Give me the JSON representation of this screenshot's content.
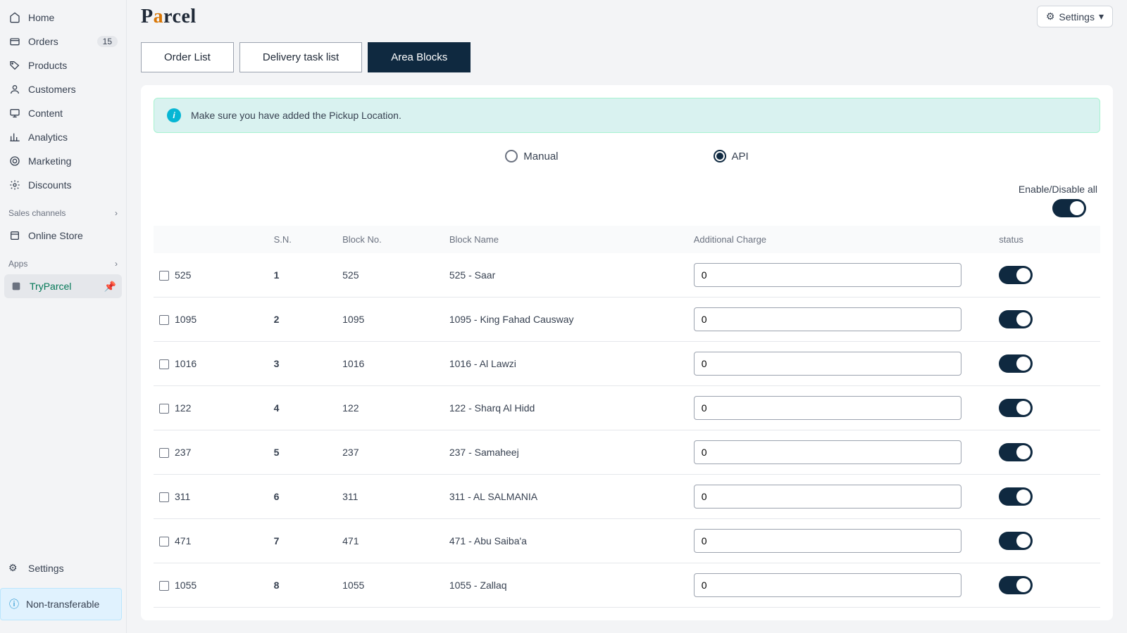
{
  "logo": "Parcel",
  "settings_button": "Settings",
  "sidebar": {
    "items": [
      {
        "icon": "home",
        "label": "Home"
      },
      {
        "icon": "inbox",
        "label": "Orders",
        "badge": "15"
      },
      {
        "icon": "tag",
        "label": "Products"
      },
      {
        "icon": "user",
        "label": "Customers"
      },
      {
        "icon": "display",
        "label": "Content"
      },
      {
        "icon": "chart",
        "label": "Analytics"
      },
      {
        "icon": "target",
        "label": "Marketing"
      },
      {
        "icon": "gear",
        "label": "Discounts"
      }
    ],
    "sales_channels_label": "Sales channels",
    "online_store_label": "Online Store",
    "apps_label": "Apps",
    "app_name": "TryParcel",
    "settings_label": "Settings",
    "footer_notice": "Non-transferable"
  },
  "tabs": [
    {
      "label": "Order List",
      "active": false
    },
    {
      "label": "Delivery task list",
      "active": false
    },
    {
      "label": "Area Blocks",
      "active": true
    }
  ],
  "alert_text": "Make sure you have added the Pickup Location.",
  "mode": {
    "manual_label": "Manual",
    "api_label": "API",
    "selected": "API"
  },
  "toggle_all_label": "Enable/Disable all",
  "table": {
    "headers": {
      "sn": "S.N.",
      "block_no": "Block No.",
      "block_name": "Block Name",
      "charge": "Additional Charge",
      "status": "status"
    },
    "rows": [
      {
        "check_label": "525",
        "sn": "1",
        "block_no": "525",
        "block_name": "525 - Saar",
        "charge": "0",
        "status": true
      },
      {
        "check_label": "1095",
        "sn": "2",
        "block_no": "1095",
        "block_name": "1095 - King Fahad Causway",
        "charge": "0",
        "status": true
      },
      {
        "check_label": "1016",
        "sn": "3",
        "block_no": "1016",
        "block_name": "1016 - Al Lawzi",
        "charge": "0",
        "status": true
      },
      {
        "check_label": "122",
        "sn": "4",
        "block_no": "122",
        "block_name": "122 - Sharq Al Hidd",
        "charge": "0",
        "status": true
      },
      {
        "check_label": "237",
        "sn": "5",
        "block_no": "237",
        "block_name": "237 - Samaheej",
        "charge": "0",
        "status": true
      },
      {
        "check_label": "311",
        "sn": "6",
        "block_no": "311",
        "block_name": "311 - AL SALMANIA",
        "charge": "0",
        "status": true
      },
      {
        "check_label": "471",
        "sn": "7",
        "block_no": "471",
        "block_name": "471 - Abu Saiba'a",
        "charge": "0",
        "status": true
      },
      {
        "check_label": "1055",
        "sn": "8",
        "block_no": "1055",
        "block_name": "1055 - Zallaq",
        "charge": "0",
        "status": true
      }
    ]
  }
}
